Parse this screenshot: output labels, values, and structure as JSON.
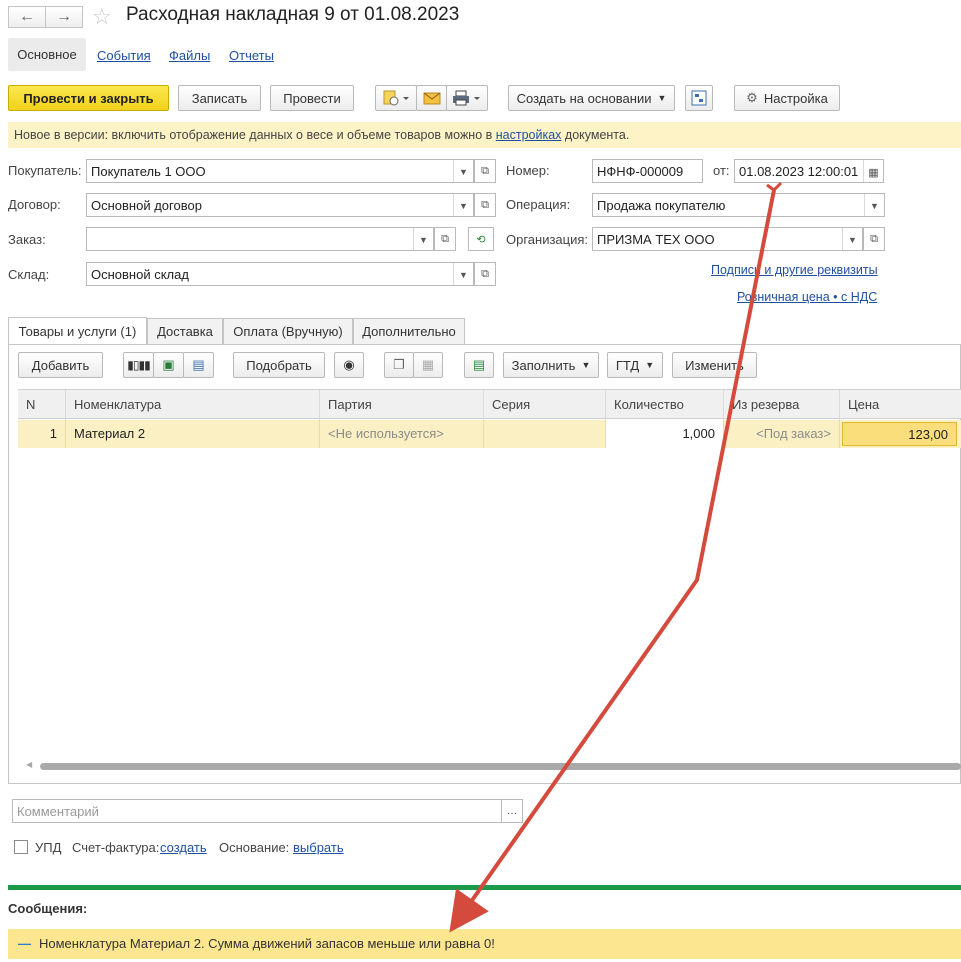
{
  "window": {
    "title": "Расходная накладная 9 от 01.08.2023",
    "back_icon": "←",
    "forward_icon": "→",
    "star_icon": "☆"
  },
  "top_tabs": {
    "active": "Основное",
    "links": [
      "События",
      "Файлы",
      "Отчеты"
    ]
  },
  "toolbar": {
    "post_close": "Провести и закрыть",
    "save": "Записать",
    "post": "Провести",
    "create_based": "Создать на основании",
    "settings": "Настройка"
  },
  "banner": {
    "text_before": "Новое в версии: включить отображение данных о весе и объеме товаров можно в ",
    "link": "настройках",
    "text_after": " документа."
  },
  "form": {
    "buyer_label": "Покупатель:",
    "buyer_value": "Покупатель 1 ООО",
    "contract_label": "Договор:",
    "contract_value": "Основной договор",
    "order_label": "Заказ:",
    "order_value": "",
    "warehouse_label": "Склад:",
    "warehouse_value": "Основной склад",
    "number_label": "Номер:",
    "number_value": "НФНФ-000009",
    "from_label": "от:",
    "date_value": "01.08.2023 12:00:01",
    "operation_label": "Операция:",
    "operation_value": "Продажа покупателю",
    "organization_label": "Организация:",
    "organization_value": "ПРИЗМА ТЕХ ООО",
    "signatures_link": "Подписи и другие реквизиты",
    "price_link": "Розничная цена • с НДС"
  },
  "doc_tabs": [
    "Товары и услуги (1)",
    "Доставка",
    "Оплата (Вручную)",
    "Дополнительно"
  ],
  "table_toolbar": {
    "add": "Добавить",
    "pick": "Подобрать",
    "fill": "Заполнить",
    "gtd": "ГТД",
    "change": "Изменить"
  },
  "table": {
    "columns": [
      "N",
      "Номенклатура",
      "Партия",
      "Серия",
      "Количество",
      "Из резерва",
      "Цена"
    ],
    "rows": [
      {
        "n": "1",
        "item": "Материал 2",
        "batch": "<Не используется>",
        "series": "",
        "qty": "1,000",
        "reserve": "<Под заказ>",
        "price": "123,00"
      }
    ]
  },
  "comment": {
    "placeholder": "Комментарий"
  },
  "footer": {
    "upd_label": "УПД",
    "invoice_label": "Счет-фактура:",
    "invoice_link": "создать",
    "basis_label": "Основание:",
    "basis_link": "выбрать"
  },
  "messages": {
    "title": "Сообщения:",
    "dash": "—",
    "text": "Номенклатура Материал 2. Сумма движений запасов меньше или равна 0!"
  },
  "colors": {
    "primary_button": "#f1d21a",
    "banner_bg": "#fdf3c7",
    "row_highlight": "#fbf0c4",
    "message_bg": "#fde690",
    "messages_divider": "#1c9a4b",
    "annotation_arrow": "#d44a3c",
    "link": "#1f50a0"
  }
}
